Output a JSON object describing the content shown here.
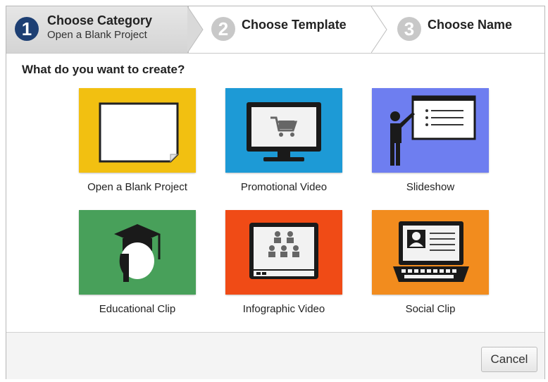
{
  "wizard": {
    "steps": [
      {
        "number": "1",
        "title": "Choose Category",
        "subtitle": "Open a Blank Project"
      },
      {
        "number": "2",
        "title": "Choose Template"
      },
      {
        "number": "3",
        "title": "Choose Name"
      }
    ]
  },
  "prompt": "What do you want to create?",
  "categories": [
    {
      "label": "Open a Blank Project",
      "color": "#f2c011",
      "icon": "blank-page-icon"
    },
    {
      "label": "Promotional Video",
      "color": "#1d9ad6",
      "icon": "monitor-cart-icon"
    },
    {
      "label": "Slideshow",
      "color": "#6e7ef0",
      "icon": "presenter-icon"
    },
    {
      "label": "Educational Clip",
      "color": "#48a05a",
      "icon": "graduate-icon"
    },
    {
      "label": "Infographic Video",
      "color": "#f04b16",
      "icon": "audience-screen-icon"
    },
    {
      "label": "Social Clip",
      "color": "#f28c1e",
      "icon": "laptop-profile-icon"
    }
  ],
  "footer": {
    "cancel_label": "Cancel"
  }
}
